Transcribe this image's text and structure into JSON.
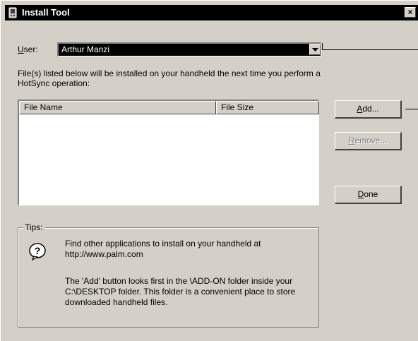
{
  "window": {
    "title": "Install Tool",
    "close_glyph": "×",
    "icon": "palm-handheld-icon"
  },
  "user": {
    "label_prefix": "",
    "label_accel": "U",
    "label_rest": "ser:",
    "value": "Arthur Manzi"
  },
  "description": "File(s) listed below will be installed on your handheld the next time you perform a HotSync operation:",
  "file_list": {
    "columns": [
      "File Name",
      "File Size"
    ],
    "rows": []
  },
  "buttons": {
    "add": {
      "accel": "A",
      "rest": "dd...",
      "enabled": true
    },
    "remove": {
      "accel": "R",
      "rest": "emove...",
      "enabled": false
    },
    "done": {
      "accel": "D",
      "rest": "one",
      "enabled": true
    }
  },
  "tips": {
    "label": "Tips:",
    "icon": "question-icon",
    "line1": "Find other applications to install on your handheld at http://www.palm.com",
    "line2": "The 'Add' button looks first in the \\ADD-ON folder inside your C:\\DESKTOP folder. This folder is a convenient place to store downloaded handheld files."
  },
  "colors": {
    "face": "#d4d0c8",
    "titlebar": "#000000",
    "selection": "#000000"
  }
}
